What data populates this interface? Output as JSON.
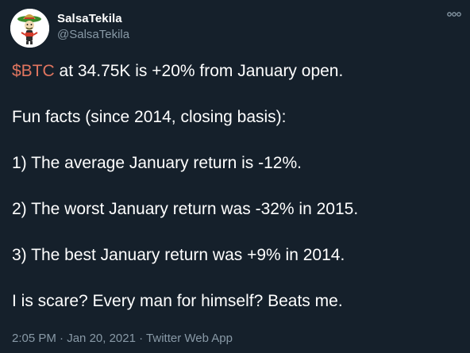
{
  "author": {
    "display_name": "SalsaTekila",
    "handle": "@SalsaTekila",
    "avatar_icon": "avatar-image"
  },
  "menu": {
    "icon": "more-icon"
  },
  "tweet": {
    "line1_cashtag": "$BTC",
    "line1_rest": " at 34.75K is +20% from January open.",
    "line2": "Fun facts (since 2014, closing basis):",
    "line3": "1) The average January return is -12%.",
    "line4": "2) The worst January return was -32% in 2015.",
    "line5": "3) The best January return was +9% in 2014.",
    "line6": "I is scare? Every man for himself? Beats me."
  },
  "meta": {
    "time": "2:05 PM",
    "separator1": " · ",
    "date": "Jan 20, 2021",
    "separator2": " · ",
    "source": "Twitter Web App"
  },
  "colors": {
    "background": "#15202b",
    "text": "#ffffff",
    "muted": "#8899a6",
    "cashtag": "#e0755f"
  }
}
